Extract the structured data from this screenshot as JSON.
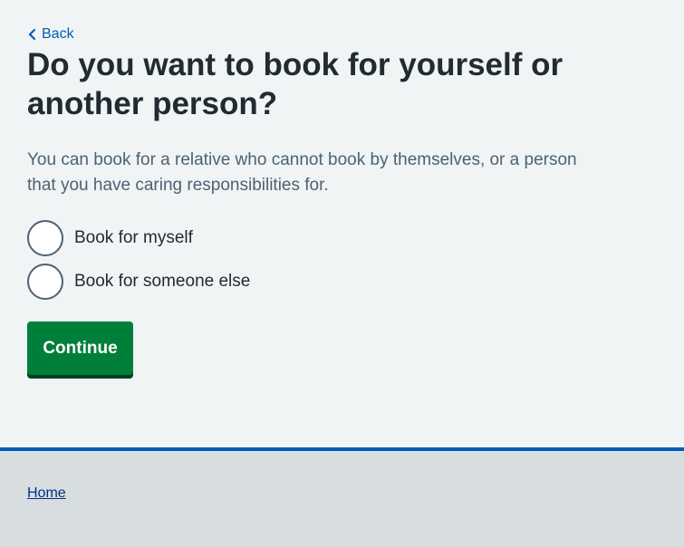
{
  "nav": {
    "back_label": "Back",
    "back_icon": "chevron-left-icon"
  },
  "page": {
    "title": "Do you want to book for yourself or another person?",
    "hint": "You can book for a relative who cannot book by themselves, or a person that you have caring responsibilities for."
  },
  "options": [
    {
      "label": "Book for myself",
      "selected": false
    },
    {
      "label": "Book for someone else",
      "selected": false
    }
  ],
  "actions": {
    "continue_label": "Continue"
  },
  "footer": {
    "home_label": "Home"
  },
  "colors": {
    "background": "#f0f4f5",
    "link": "#005eb8",
    "text": "#212b32",
    "secondary_text": "#4c6272",
    "button": "#007f3b",
    "button_shadow": "#00401e",
    "footer_bg": "#d8dde0",
    "footer_border": "#005eb8",
    "footer_link": "#003087"
  }
}
